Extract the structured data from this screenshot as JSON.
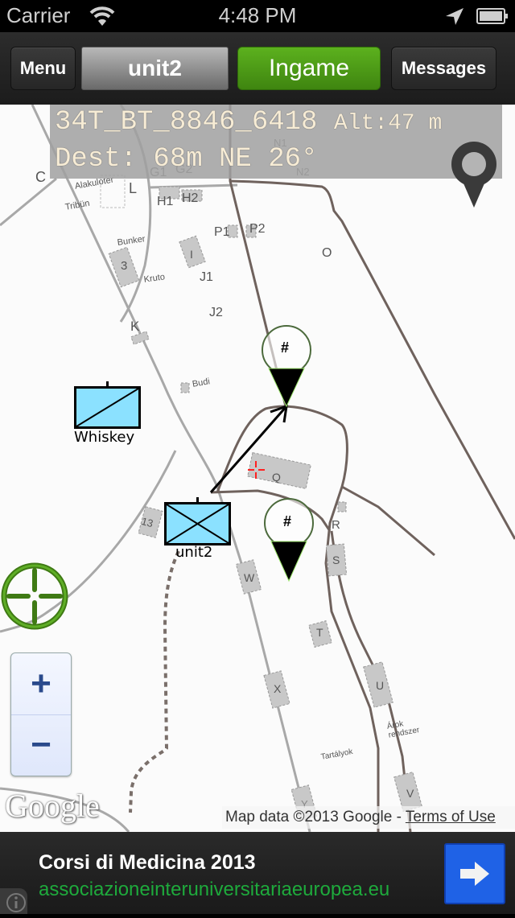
{
  "status_bar": {
    "carrier": "Carrier",
    "time": "4:48 PM",
    "icons": [
      "wifi-icon",
      "location-arrow-icon",
      "battery-icon"
    ]
  },
  "toolbar": {
    "menu_label": "Menu",
    "unit_label": "unit2",
    "mode_label": "Ingame",
    "messages_label": "Messages",
    "mode_color": "#4f9a17"
  },
  "coords": {
    "grid": "34T_BT_8846_6418",
    "alt": "Alt:47 m",
    "dest": "Dest: 68m NE 26°"
  },
  "map": {
    "units": [
      {
        "name": "Whiskey",
        "symbol": "single-diagonal",
        "color": "#8be1ff"
      },
      {
        "name": "unit2",
        "symbol": "cross",
        "color": "#8be1ff"
      }
    ],
    "waypoint_marker_label": "#",
    "labels": [
      {
        "text": "C"
      },
      {
        "text": "Alakuloter"
      },
      {
        "text": "Tribün"
      },
      {
        "text": "L"
      },
      {
        "text": "G1"
      },
      {
        "text": "G2"
      },
      {
        "text": "H1"
      },
      {
        "text": "H2"
      },
      {
        "text": "N1"
      },
      {
        "text": "N2"
      },
      {
        "text": "P1"
      },
      {
        "text": "P2"
      },
      {
        "text": "O"
      },
      {
        "text": "Bunker"
      },
      {
        "text": "3"
      },
      {
        "text": "Kruto"
      },
      {
        "text": "I"
      },
      {
        "text": "J1"
      },
      {
        "text": "J2"
      },
      {
        "text": "K"
      },
      {
        "text": "Budi"
      },
      {
        "text": "Q"
      },
      {
        "text": "13"
      },
      {
        "text": "R"
      },
      {
        "text": "S"
      },
      {
        "text": "W"
      },
      {
        "text": "T"
      },
      {
        "text": "X"
      },
      {
        "text": "U"
      },
      {
        "text": "Árok rendszer"
      },
      {
        "text": "Tartályok"
      },
      {
        "text": "V"
      },
      {
        "text": "Y"
      }
    ],
    "zoom_in": "+",
    "zoom_out": "−",
    "google_logo": "Google",
    "attribution": "Map data ©2013 Google - ",
    "terms": "Terms of Use"
  },
  "ad": {
    "title": "Corsi di Medicina 2013",
    "url": "associazioneinteruniversitariaeuropea.eu",
    "go_icon": "arrow-right-icon",
    "info_icon": "info-icon"
  }
}
